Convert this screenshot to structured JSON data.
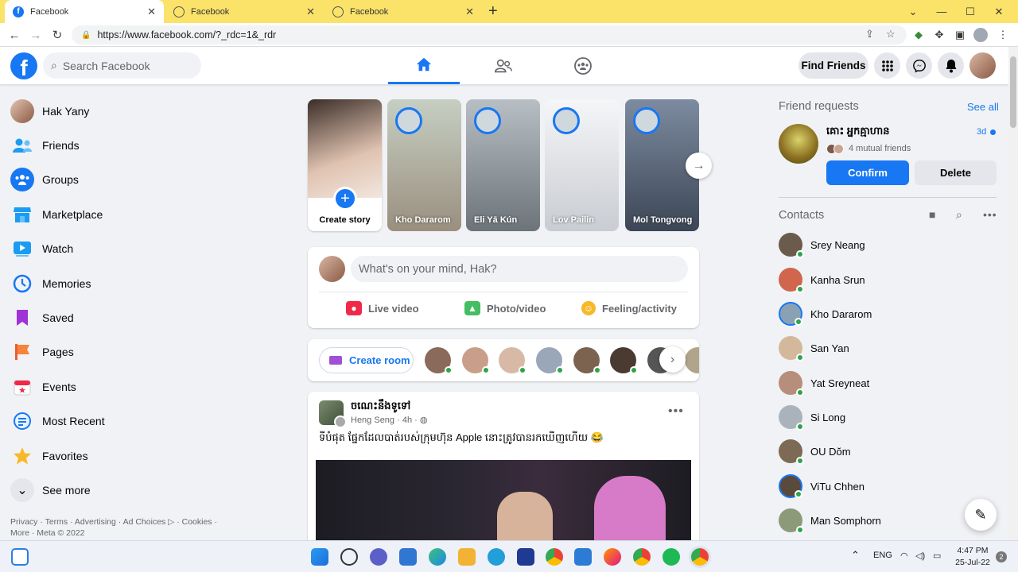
{
  "browser": {
    "tabs": [
      {
        "title": "Facebook",
        "active": true
      },
      {
        "title": "Facebook",
        "active": false
      },
      {
        "title": "Facebook",
        "active": false
      }
    ],
    "url": "https://www.facebook.com/?_rdc=1&_rdr"
  },
  "header": {
    "logo": "f",
    "search_placeholder": "Search Facebook",
    "find_friends": "Find Friends"
  },
  "left_nav": {
    "items": [
      {
        "label": "Hak Yany",
        "icon": "profile-avatar",
        "color": "#b88a6f"
      },
      {
        "label": "Friends",
        "icon": "friends-icon",
        "color": "#1b9cf2"
      },
      {
        "label": "Groups",
        "icon": "groups-icon",
        "color": "#1877f2"
      },
      {
        "label": "Marketplace",
        "icon": "marketplace-icon",
        "color": "#1b9cf2"
      },
      {
        "label": "Watch",
        "icon": "watch-icon",
        "color": "#1b9cf2"
      },
      {
        "label": "Memories",
        "icon": "memories-icon",
        "color": "#1877f2"
      },
      {
        "label": "Saved",
        "icon": "saved-icon",
        "color": "#a033d6"
      },
      {
        "label": "Pages",
        "icon": "pages-icon",
        "color": "#f25a2f"
      },
      {
        "label": "Events",
        "icon": "events-icon",
        "color": "#f02849"
      },
      {
        "label": "Most Recent",
        "icon": "most-recent-icon",
        "color": "#1877f2"
      },
      {
        "label": "Favorites",
        "icon": "favorites-icon",
        "color": "#f7b928"
      },
      {
        "label": "See more",
        "icon": "chevron-down-icon",
        "color": "#e4e6eb"
      }
    ],
    "legal_line1": "Privacy · Terms · Advertising · Ad Choices ▷ · Cookies ·",
    "legal_line2": "More · Meta © 2022"
  },
  "stories": {
    "create_label": "Create story",
    "items": [
      {
        "name": "Kho Dararom",
        "color": "#b7c2b3"
      },
      {
        "name": "Eli Yā Kún",
        "color": "#9aa3a8"
      },
      {
        "name": "Lov Pailin",
        "color": "#e9ebee"
      },
      {
        "name": "Mol Tongvong",
        "color": "#5d6d83"
      }
    ]
  },
  "composer": {
    "placeholder": "What's on your mind, Hak?",
    "actions": [
      {
        "label": "Live video",
        "color": "#f02849"
      },
      {
        "label": "Photo/video",
        "color": "#45bd62"
      },
      {
        "label": "Feeling/activity",
        "color": "#f7b928"
      }
    ]
  },
  "rooms": {
    "create_label": "Create room",
    "avatar_colors": [
      "#8a6a5a",
      "#c99f8a",
      "#d7b9a5",
      "#9aa7b8",
      "#7b6350",
      "#4a3a32",
      "#555555",
      "#b0a48a"
    ]
  },
  "post": {
    "title": "ចណេះនឹងទូទៅ",
    "author": "Heng Seng",
    "time": "4h",
    "text": "ទីបំផុត ផ្នែកដែលបាត់របស់ក្រុមហ៊ុន Apple នោះត្រូវបានរកឃើញហើយ 😂"
  },
  "friend_requests": {
    "heading": "Friend requests",
    "see_all": "See all",
    "name": "គោះ អ្នកគ្មាហាន",
    "time": "3d",
    "mutual": "4 mutual friends",
    "confirm": "Confirm",
    "delete": "Delete"
  },
  "contacts": {
    "heading": "Contacts",
    "items": [
      {
        "name": "Srey Neang",
        "color": "#6b5b4b",
        "ring": false
      },
      {
        "name": "Kanha Srun",
        "color": "#d0664d",
        "ring": false
      },
      {
        "name": "Kho Dararom",
        "color": "#8aa1b4",
        "ring": true
      },
      {
        "name": "San Yan",
        "color": "#d4b89c",
        "ring": false
      },
      {
        "name": "Yat Sreyneat",
        "color": "#b78d7c",
        "ring": false
      },
      {
        "name": "Si Long",
        "color": "#aab3bc",
        "ring": false
      },
      {
        "name": "OU Dŏm",
        "color": "#7c6a55",
        "ring": false
      },
      {
        "name": "ViTu Chhen",
        "color": "#5a4a3c",
        "ring": true
      },
      {
        "name": "Man Somphorn",
        "color": "#8c9a7a",
        "ring": false
      }
    ]
  },
  "taskbar": {
    "language": "ENG",
    "time": "4:47 PM",
    "date": "25-Jul-22",
    "notifications": "2",
    "app_colors": [
      "#2b7de9",
      "#333333",
      "#5b5fc7",
      "#2f77d1",
      "#1e88e5",
      "#f2b233",
      "#229ed9",
      "#1f3a93",
      "#ea4335",
      "#2c7cd6",
      "#ff7139",
      "#ea4335",
      "#1db954",
      "#ea4335"
    ]
  }
}
